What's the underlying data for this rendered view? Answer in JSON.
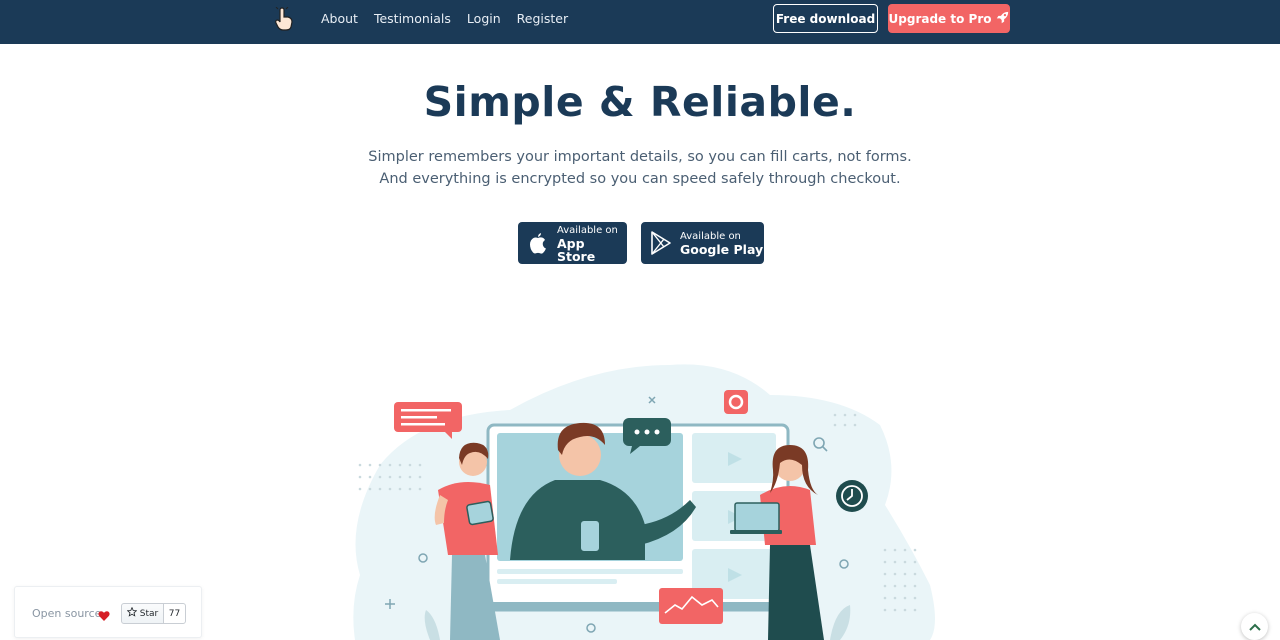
{
  "nav": {
    "logo_icon": "hand-pointer-icon",
    "links": [
      "About",
      "Testimonials",
      "Login",
      "Register"
    ],
    "free_download": "Free download",
    "upgrade": "Upgrade to Pro",
    "upgrade_icon": "rocket-icon"
  },
  "hero": {
    "title": "Simple & Reliable.",
    "subtitle": "Simpler remembers your important details, so you can fill carts, not forms. And everything is encrypted so you can speed safely through checkout."
  },
  "stores": {
    "apple": {
      "small": "Available on",
      "big": "App Store",
      "icon": "apple-icon"
    },
    "google": {
      "small": "Available on",
      "big": "Google Play",
      "icon": "google-play-icon"
    }
  },
  "open_source": {
    "label": "Open source",
    "icon": "heart-icon",
    "star_label": "Star",
    "star_count": "77"
  },
  "scroll_top_icon": "chevron-up-icon",
  "colors": {
    "navy": "#1b3a57",
    "coral": "#f26565",
    "teal_dark": "#2c5f5d",
    "teal_light": "#a6d3dc"
  }
}
